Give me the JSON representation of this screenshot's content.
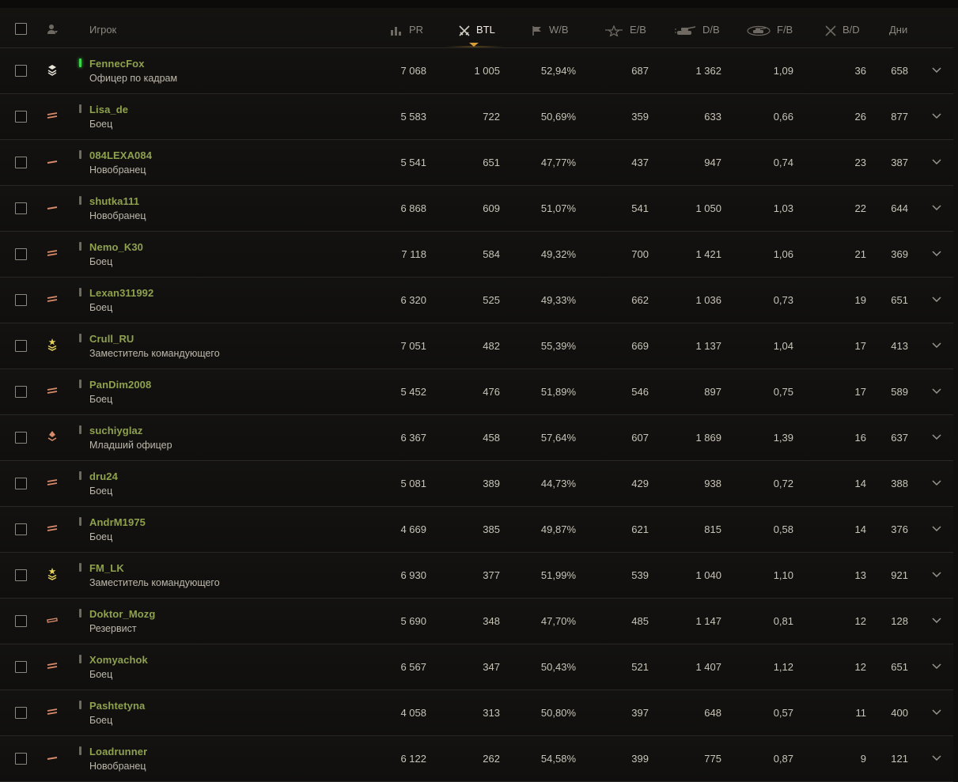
{
  "header": {
    "select_all": "",
    "player": "Игрок",
    "pr": "PR",
    "btl": "BTL",
    "wb": "W/B",
    "eb": "E/B",
    "db": "D/B",
    "fb": "F/B",
    "bd": "B/D",
    "days": "Дни",
    "sorted_column": "BTL",
    "accent_color": "#d89c3a",
    "name_color": "#8ea14f",
    "online_color": "#3fd24a"
  },
  "rows": [
    {
      "name": "FennecFox",
      "role": "Офицер по кадрам",
      "rank_icon": "personnel-officer-rank-icon",
      "online": true,
      "pr": "7 068",
      "btl": "1 005",
      "wb": "52,94%",
      "eb": "687",
      "db": "1 362",
      "fb": "1,09",
      "bd": "36",
      "days": "658"
    },
    {
      "name": "Lisa_de",
      "role": "Боец",
      "rank_icon": "private-rank-icon",
      "online": false,
      "pr": "5 583",
      "btl": "722",
      "wb": "50,69%",
      "eb": "359",
      "db": "633",
      "fb": "0,66",
      "bd": "26",
      "days": "877"
    },
    {
      "name": "084LEXA084",
      "role": "Новобранец",
      "rank_icon": "recruit-rank-icon",
      "online": false,
      "pr": "5 541",
      "btl": "651",
      "wb": "47,77%",
      "eb": "437",
      "db": "947",
      "fb": "0,74",
      "bd": "23",
      "days": "387"
    },
    {
      "name": "shutka111",
      "role": "Новобранец",
      "rank_icon": "recruit-rank-icon",
      "online": false,
      "pr": "6 868",
      "btl": "609",
      "wb": "51,07%",
      "eb": "541",
      "db": "1 050",
      "fb": "1,03",
      "bd": "22",
      "days": "644"
    },
    {
      "name": "Nemo_K30",
      "role": "Боец",
      "rank_icon": "private-rank-icon",
      "online": false,
      "pr": "7 118",
      "btl": "584",
      "wb": "49,32%",
      "eb": "700",
      "db": "1 421",
      "fb": "1,06",
      "bd": "21",
      "days": "369"
    },
    {
      "name": "Lexan311992",
      "role": "Боец",
      "rank_icon": "private-rank-icon",
      "online": false,
      "pr": "6 320",
      "btl": "525",
      "wb": "49,33%",
      "eb": "662",
      "db": "1 036",
      "fb": "0,73",
      "bd": "19",
      "days": "651"
    },
    {
      "name": "Crull_RU",
      "role": "Заместитель командующего",
      "rank_icon": "deputy-commander-rank-icon",
      "online": false,
      "pr": "7 051",
      "btl": "482",
      "wb": "55,39%",
      "eb": "669",
      "db": "1 137",
      "fb": "1,04",
      "bd": "17",
      "days": "413"
    },
    {
      "name": "PanDim2008",
      "role": "Боец",
      "rank_icon": "private-rank-icon",
      "online": false,
      "pr": "5 452",
      "btl": "476",
      "wb": "51,89%",
      "eb": "546",
      "db": "897",
      "fb": "0,75",
      "bd": "17",
      "days": "589"
    },
    {
      "name": "suchiyglaz",
      "role": "Младший офицер",
      "rank_icon": "junior-officer-rank-icon",
      "online": false,
      "pr": "6 367",
      "btl": "458",
      "wb": "57,64%",
      "eb": "607",
      "db": "1 869",
      "fb": "1,39",
      "bd": "16",
      "days": "637"
    },
    {
      "name": "dru24",
      "role": "Боец",
      "rank_icon": "private-rank-icon",
      "online": false,
      "pr": "5 081",
      "btl": "389",
      "wb": "44,73%",
      "eb": "429",
      "db": "938",
      "fb": "0,72",
      "bd": "14",
      "days": "388"
    },
    {
      "name": "AndrM1975",
      "role": "Боец",
      "rank_icon": "private-rank-icon",
      "online": false,
      "pr": "4 669",
      "btl": "385",
      "wb": "49,87%",
      "eb": "621",
      "db": "815",
      "fb": "0,58",
      "bd": "14",
      "days": "376"
    },
    {
      "name": "FM_LK",
      "role": "Заместитель командующего",
      "rank_icon": "deputy-commander-rank-icon",
      "online": false,
      "pr": "6 930",
      "btl": "377",
      "wb": "51,99%",
      "eb": "539",
      "db": "1 040",
      "fb": "1,10",
      "bd": "13",
      "days": "921"
    },
    {
      "name": "Doktor_Mozg",
      "role": "Резервист",
      "rank_icon": "reservist-rank-icon",
      "online": false,
      "pr": "5 690",
      "btl": "348",
      "wb": "47,70%",
      "eb": "485",
      "db": "1 147",
      "fb": "0,81",
      "bd": "12",
      "days": "128"
    },
    {
      "name": "Xomyachok",
      "role": "Боец",
      "rank_icon": "private-rank-icon",
      "online": false,
      "pr": "6 567",
      "btl": "347",
      "wb": "50,43%",
      "eb": "521",
      "db": "1 407",
      "fb": "1,12",
      "bd": "12",
      "days": "651"
    },
    {
      "name": "Pashtetyna",
      "role": "Боец",
      "rank_icon": "private-rank-icon",
      "online": false,
      "pr": "4 058",
      "btl": "313",
      "wb": "50,80%",
      "eb": "397",
      "db": "648",
      "fb": "0,57",
      "bd": "11",
      "days": "400"
    },
    {
      "name": "Loadrunner",
      "role": "Новобранец",
      "rank_icon": "recruit-rank-icon",
      "online": false,
      "pr": "6 122",
      "btl": "262",
      "wb": "54,58%",
      "eb": "399",
      "db": "775",
      "fb": "0,87",
      "bd": "9",
      "days": "121"
    }
  ]
}
